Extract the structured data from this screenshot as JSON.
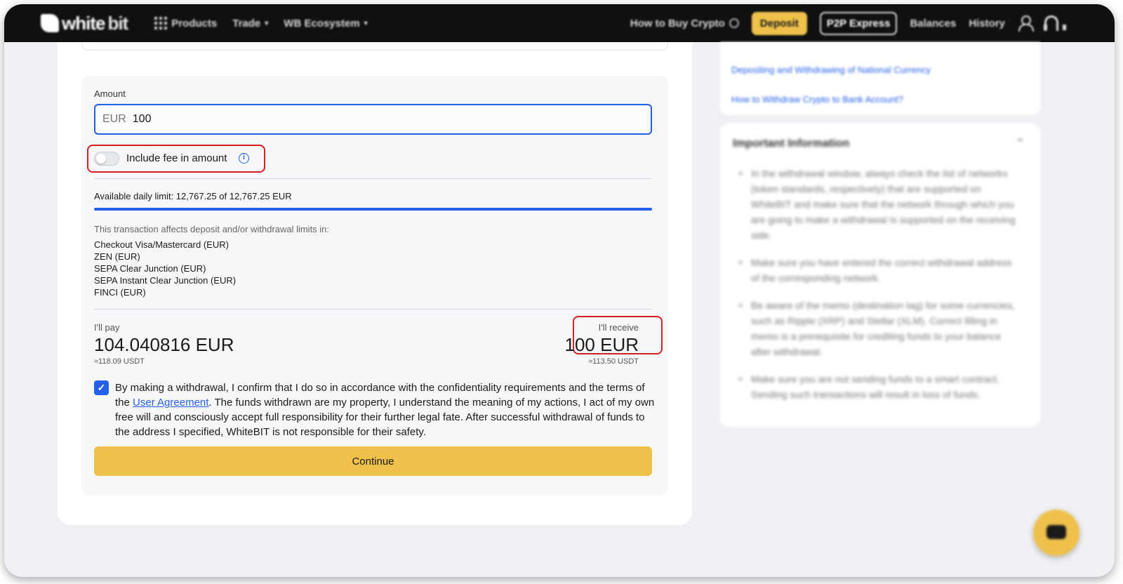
{
  "header": {
    "logo_white": "white",
    "logo_bit": "bit",
    "nav": {
      "products": "Products",
      "trade": "Trade",
      "ecosystem": "WB Ecosystem"
    },
    "right": {
      "how_to_buy": "How to Buy Crypto",
      "deposit": "Deposit",
      "p2p": "P2P Express",
      "balances": "Balances",
      "history": "History"
    }
  },
  "form": {
    "amount_label": "Amount",
    "amount_currency": "EUR",
    "amount_value": "100",
    "include_fee_label": "Include fee in amount",
    "include_fee_on": false,
    "limit_text": "Available daily limit: 12,767.25 of 12,767.25 EUR",
    "limit_fraction": 1.0,
    "affects_label": "This transaction affects deposit and/or withdrawal limits in:",
    "affects_items": [
      "Checkout Visa/Mastercard (EUR)",
      "ZEN (EUR)",
      "SEPA Clear Junction (EUR)",
      "SEPA Instant Clear Junction (EUR)",
      "FINCI (EUR)"
    ],
    "pay_label": "I'll pay",
    "pay_value": "104.040816 EUR",
    "pay_usdt": "≈118.09 USDT",
    "receive_label": "I'll receive",
    "receive_value": "100 EUR",
    "receive_usdt": "≈113.50 USDT",
    "agreement_checked": true,
    "agreement_before": "By making a withdrawal, I confirm that I do so in accordance with the confidentiality requirements and the terms of the ",
    "agreement_link": "User Agreement",
    "agreement_after": ". The funds withdrawn are my property, I understand the meaning of my actions, I act of my own free will and consciously accept full responsibility for their further legal fate. After successful withdrawal of funds to the address I specified, WhiteBIT is not responsible for their safety.",
    "continue_label": "Continue"
  },
  "sidebar": {
    "links": [
      "Depositing and Withdrawing of National Currency",
      "How to Withdraw Crypto to Bank Account?"
    ],
    "info_title": "Important Information",
    "info_items": [
      "In the withdrawal window, always check the list of networks (token standards, respectively) that are supported on WhiteBIT and make sure that the network through which you are going to make a withdrawal is supported on the receiving side.",
      "Make sure you have entered the correct withdrawal address of the corresponding network.",
      "Be aware of the memo (destination tag) for some currencies, such as Ripple (XRP) and Stellar (XLM). Correct filling in memo is a prerequisite for crediting funds to your balance after withdrawal.",
      "Make sure you are not sending funds to a smart contract. Sending such transactions will result in loss of funds."
    ]
  },
  "colors": {
    "accent_blue": "#2460e8",
    "brand_yellow": "#efc14b",
    "highlight_red": "#d42020",
    "header_bg": "#101010"
  }
}
